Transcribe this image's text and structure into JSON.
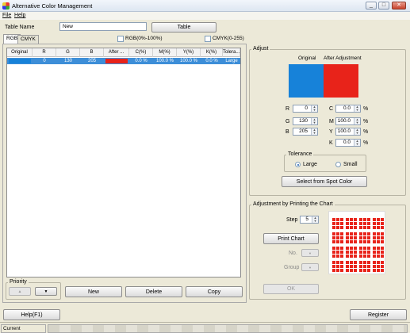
{
  "window": {
    "title": "Alternative Color Management",
    "buttons": [
      "_",
      "□",
      "✕"
    ]
  },
  "menu": {
    "file": "File",
    "help": "Help"
  },
  "table_name": {
    "label": "Table Name",
    "value": "New",
    "button": "Table"
  },
  "tabs": {
    "rgb": "RGB",
    "cmyk": "CMYK"
  },
  "checks": {
    "rgb_percent": "RGB(0%-100%)",
    "cmyk_range": "CMYK(0-255)"
  },
  "table": {
    "headers": [
      "Original",
      "R",
      "G",
      "B",
      "After ...",
      "C(%)",
      "M(%)",
      "Y(%)",
      "K(%)",
      "Tolera..."
    ],
    "rows": [
      {
        "r": "0",
        "g": "130",
        "b": "205",
        "after_color": "#e8231a",
        "c": "0.0 %",
        "m": "100.0 %",
        "y": "100.0 %",
        "k": "0.0 %",
        "tol": "Large",
        "orig_color": "#1782d9"
      }
    ]
  },
  "priority": {
    "label": "Priority",
    "up": "▲",
    "down": "▼"
  },
  "actions": {
    "new": "New",
    "delete": "Delete",
    "copy": "Copy"
  },
  "adjust": {
    "label": "Adjust",
    "original_label": "Original",
    "after_label": "After Adjustment",
    "original_color": "#1782d9",
    "after_color": "#e8231a",
    "rgb": {
      "r_label": "R",
      "r": "0",
      "g_label": "G",
      "g": "130",
      "b_label": "B",
      "b": "205"
    },
    "cmyk": {
      "c_label": "C",
      "c": "0.0",
      "m_label": "M",
      "m": "100.0",
      "y_label": "Y",
      "y": "100.0",
      "k_label": "K",
      "k": "0.0",
      "unit": "%"
    },
    "tolerance": {
      "label": "Tolerance",
      "large": "Large",
      "small": "Small",
      "selected": "Large"
    },
    "spot_button": "Select from Spot Color"
  },
  "printing": {
    "label": "Adjustment by Printing the Chart",
    "step_label": "Step",
    "step_value": "5",
    "print_button": "Print Chart",
    "no_label": "No.",
    "group_label": "Group",
    "ok_button": "OK"
  },
  "bottom": {
    "help": "Help(F1)",
    "register": "Register"
  },
  "status": {
    "current_destination": "Current Destination"
  }
}
